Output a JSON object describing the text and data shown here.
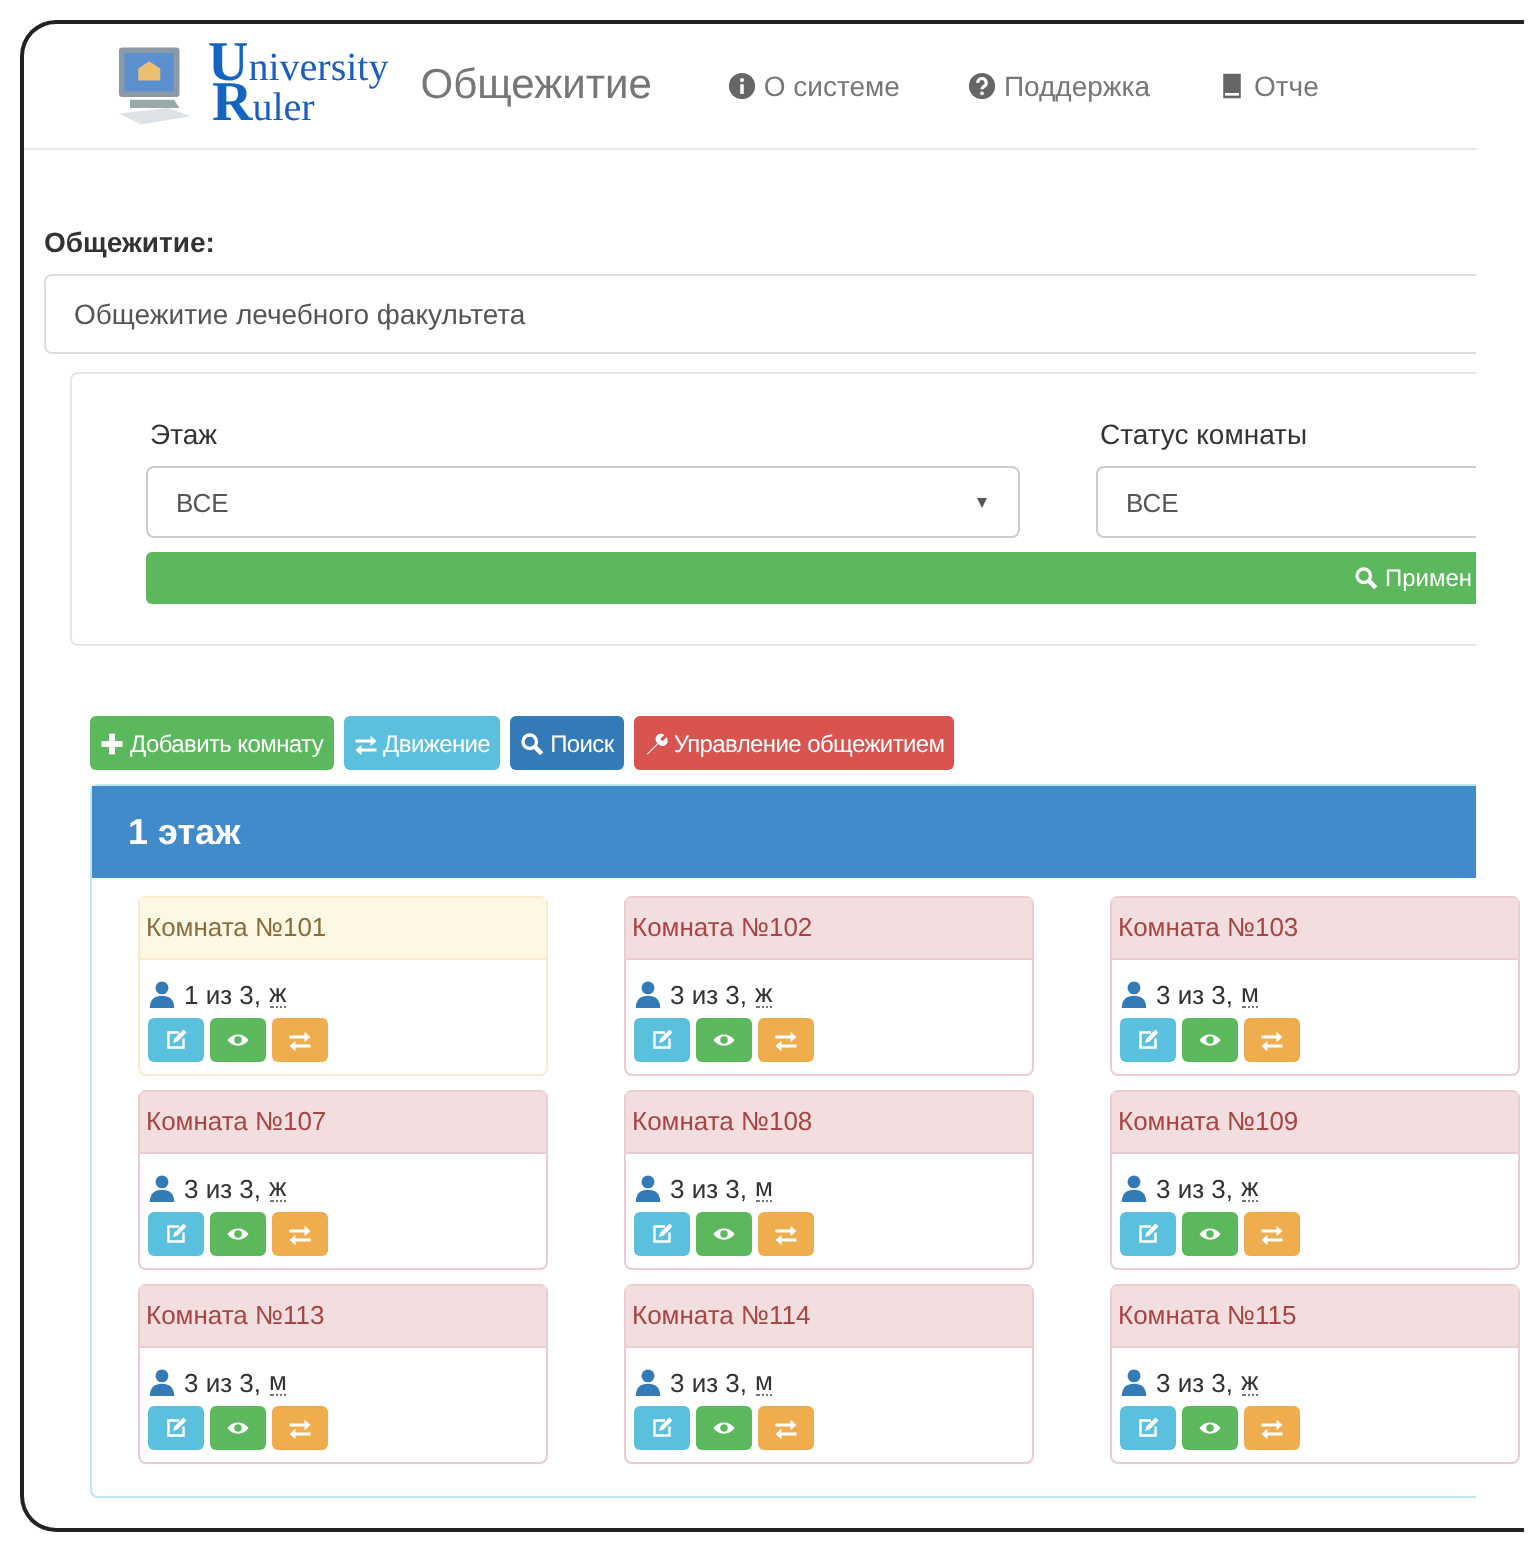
{
  "navbar": {
    "logo": [
      "University",
      "Ruler"
    ],
    "brand": "Общежитие",
    "links": [
      {
        "kind": "info",
        "label": "О системе"
      },
      {
        "kind": "question",
        "label": "Поддержка"
      },
      {
        "kind": "book",
        "label": "Отче"
      }
    ]
  },
  "dormitory": {
    "label": "Общежитие:",
    "value": "Общежитие лечебного факультета"
  },
  "filters": {
    "floor": {
      "label": "Этаж",
      "value": "ВСЕ"
    },
    "room_status": {
      "label": "Статус комнаты",
      "value": "ВСЕ"
    },
    "apply_button": "Примен"
  },
  "toolbar": [
    {
      "kind": "add",
      "label": "Добавить комнату"
    },
    {
      "kind": "move",
      "label": "Движение"
    },
    {
      "kind": "search",
      "label": "Поиск"
    },
    {
      "kind": "manage",
      "label": "Управление общежитием"
    }
  ],
  "floor_panel": {
    "title": "1 этаж",
    "rooms": [
      {
        "title": "Комната №101",
        "occupancy": "1 из 3,",
        "gender": "ж",
        "kind": "warning"
      },
      {
        "title": "Комната №102",
        "occupancy": "3 из 3,",
        "gender": "ж",
        "kind": "danger"
      },
      {
        "title": "Комната №103",
        "occupancy": "3 из 3,",
        "gender": "м",
        "kind": "danger"
      },
      {
        "title": "Комната №107",
        "occupancy": "3 из 3,",
        "gender": "ж",
        "kind": "danger"
      },
      {
        "title": "Комната №108",
        "occupancy": "3 из 3,",
        "gender": "м",
        "kind": "danger"
      },
      {
        "title": "Комната №109",
        "occupancy": "3 из 3,",
        "gender": "ж",
        "kind": "danger"
      },
      {
        "title": "Комната №113",
        "occupancy": "3 из 3,",
        "gender": "м",
        "kind": "danger"
      },
      {
        "title": "Комната №114",
        "occupancy": "3 из 3,",
        "gender": "м",
        "kind": "danger"
      },
      {
        "title": "Комната №115",
        "occupancy": "3 из 3,",
        "gender": "ж",
        "kind": "danger"
      }
    ]
  }
}
